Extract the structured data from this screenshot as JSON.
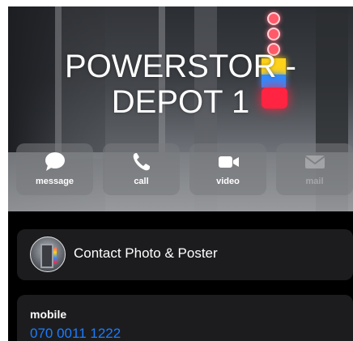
{
  "contact": {
    "name_line1": "POWERSTOR -",
    "name_line2": "DEPOT 1"
  },
  "actions": [
    {
      "label": "message",
      "icon": "message-bubble-icon",
      "enabled": true
    },
    {
      "label": "call",
      "icon": "phone-icon",
      "enabled": true
    },
    {
      "label": "video",
      "icon": "video-camera-icon",
      "enabled": true
    },
    {
      "label": "mail",
      "icon": "envelope-icon",
      "enabled": false
    }
  ],
  "photo_poster": {
    "label": "Contact Photo & Poster"
  },
  "phone": {
    "type": "mobile",
    "number": "070 0011 1222"
  },
  "colors": {
    "link": "#1a7cff",
    "card_background": "#1c1c1e",
    "screen_background": "#000000"
  }
}
